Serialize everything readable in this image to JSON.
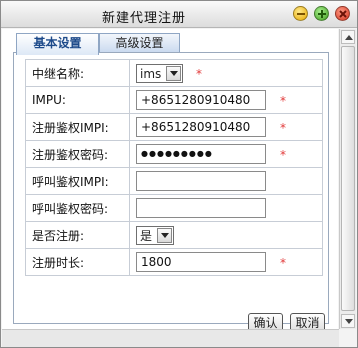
{
  "window": {
    "title": "新建代理注册"
  },
  "tabs": [
    {
      "label": "基本设置",
      "active": true
    },
    {
      "label": "高级设置",
      "active": false
    }
  ],
  "form": {
    "rows": [
      {
        "label": "中继名称:",
        "type": "select",
        "value": "ims",
        "required": true
      },
      {
        "label": "IMPU:",
        "type": "text",
        "value": "+8651280910480",
        "required": true
      },
      {
        "label": "注册鉴权IMPI:",
        "type": "text",
        "value": "+8651280910480",
        "required": true
      },
      {
        "label": "注册鉴权密码:",
        "type": "password",
        "value": "●●●●●●●●●",
        "required": true
      },
      {
        "label": "呼叫鉴权IMPI:",
        "type": "text",
        "value": "",
        "required": false
      },
      {
        "label": "呼叫鉴权密码:",
        "type": "text",
        "value": "",
        "required": false
      },
      {
        "label": "是否注册:",
        "type": "select",
        "value": "是",
        "required": false
      },
      {
        "label": "注册时长:",
        "type": "text",
        "value": "1800",
        "required": true
      }
    ],
    "required_mark": "*"
  },
  "buttons": {
    "confirm": "确认",
    "cancel": "取消"
  },
  "colors": {
    "required": "#e23b3b",
    "tab_active_text": "#1d4a8a"
  }
}
